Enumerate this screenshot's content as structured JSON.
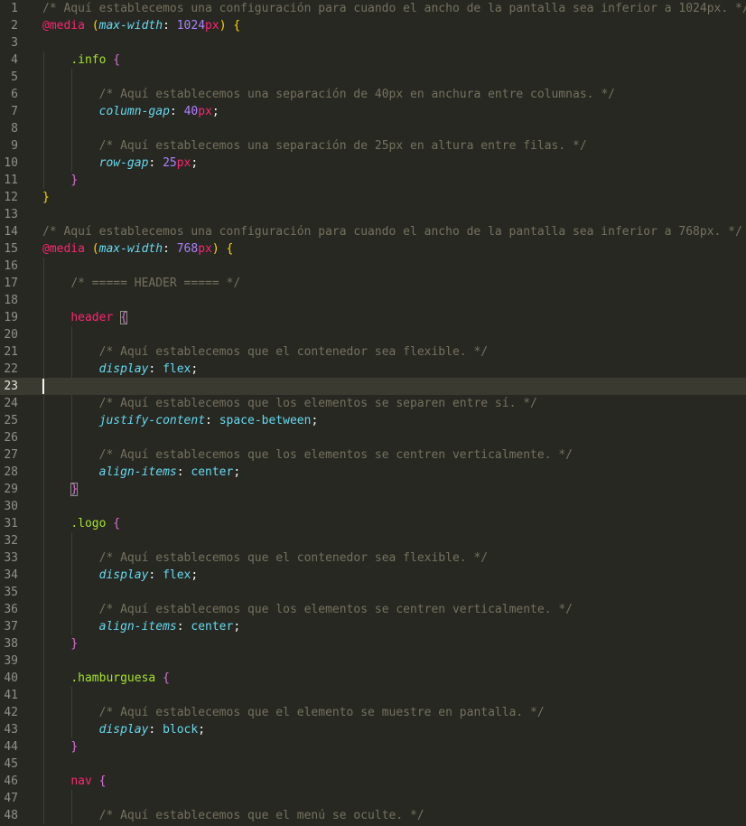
{
  "editor": {
    "active_line": 23,
    "lines": [
      {
        "n": "1",
        "tokens": [
          {
            "t": "/* Aquí establecemos una configuración para cuando el ancho de la pantalla sea inferior a 1024px. */",
            "k": "c"
          }
        ]
      },
      {
        "n": "2",
        "tokens": [
          {
            "t": "@media",
            "k": "at"
          },
          {
            "t": " "
          },
          {
            "t": "(",
            "k": "b1"
          },
          {
            "t": "max-width",
            "k": "pp"
          },
          {
            "t": ": "
          },
          {
            "t": "1024",
            "k": "n"
          },
          {
            "t": "px",
            "k": "u"
          },
          {
            "t": ")",
            "k": "b1"
          },
          {
            "t": " "
          },
          {
            "t": "{",
            "k": "b1"
          }
        ]
      },
      {
        "n": "3",
        "tokens": []
      },
      {
        "n": "4",
        "g": 1,
        "tokens": [
          {
            "t": "    "
          },
          {
            "t": ".info",
            "k": "s"
          },
          {
            "t": " "
          },
          {
            "t": "{",
            "k": "b2"
          }
        ]
      },
      {
        "n": "5",
        "g": 2,
        "tokens": []
      },
      {
        "n": "6",
        "g": 2,
        "tokens": [
          {
            "t": "        "
          },
          {
            "t": "/* Aquí establecemos una separación de 40px en anchura entre columnas. */",
            "k": "c"
          }
        ]
      },
      {
        "n": "7",
        "g": 2,
        "tokens": [
          {
            "t": "        "
          },
          {
            "t": "column-gap",
            "k": "pp"
          },
          {
            "t": ": "
          },
          {
            "t": "40",
            "k": "n"
          },
          {
            "t": "px",
            "k": "u"
          },
          {
            "t": ";"
          }
        ]
      },
      {
        "n": "8",
        "g": 2,
        "tokens": []
      },
      {
        "n": "9",
        "g": 2,
        "tokens": [
          {
            "t": "        "
          },
          {
            "t": "/* Aquí establecemos una separación de 25px en altura entre filas. */",
            "k": "c"
          }
        ]
      },
      {
        "n": "10",
        "g": 2,
        "tokens": [
          {
            "t": "        "
          },
          {
            "t": "row-gap",
            "k": "pp"
          },
          {
            "t": ": "
          },
          {
            "t": "25",
            "k": "n"
          },
          {
            "t": "px",
            "k": "u"
          },
          {
            "t": ";"
          }
        ]
      },
      {
        "n": "11",
        "g": 1,
        "tokens": [
          {
            "t": "    "
          },
          {
            "t": "}",
            "k": "b2"
          }
        ]
      },
      {
        "n": "12",
        "tokens": [
          {
            "t": "}",
            "k": "b1"
          }
        ]
      },
      {
        "n": "13",
        "tokens": []
      },
      {
        "n": "14",
        "tokens": [
          {
            "t": "/* Aquí establecemos una configuración para cuando el ancho de la pantalla sea inferior a 768px. */",
            "k": "c"
          }
        ]
      },
      {
        "n": "15",
        "tokens": [
          {
            "t": "@media",
            "k": "at"
          },
          {
            "t": " "
          },
          {
            "t": "(",
            "k": "b1"
          },
          {
            "t": "max-width",
            "k": "pp"
          },
          {
            "t": ": "
          },
          {
            "t": "768",
            "k": "n"
          },
          {
            "t": "px",
            "k": "u"
          },
          {
            "t": ")",
            "k": "b1"
          },
          {
            "t": " "
          },
          {
            "t": "{",
            "k": "b1"
          }
        ]
      },
      {
        "n": "16",
        "g": 1,
        "tokens": []
      },
      {
        "n": "17",
        "g": 1,
        "tokens": [
          {
            "t": "    "
          },
          {
            "t": "/* ===== HEADER ===== */",
            "k": "c"
          }
        ]
      },
      {
        "n": "18",
        "g": 1,
        "tokens": []
      },
      {
        "n": "19",
        "g": 1,
        "tokens": [
          {
            "t": "    "
          },
          {
            "t": "header",
            "k": "t"
          },
          {
            "t": " "
          },
          {
            "t": "{",
            "k": "b2",
            "hl": true
          }
        ]
      },
      {
        "n": "20",
        "g": 2,
        "tokens": []
      },
      {
        "n": "21",
        "g": 2,
        "tokens": [
          {
            "t": "        "
          },
          {
            "t": "/* Aquí establecemos que el contenedor sea flexible. */",
            "k": "c"
          }
        ]
      },
      {
        "n": "22",
        "g": 2,
        "tokens": [
          {
            "t": "        "
          },
          {
            "t": "display",
            "k": "pp"
          },
          {
            "t": ": "
          },
          {
            "t": "flex",
            "k": "k"
          },
          {
            "t": ";"
          }
        ]
      },
      {
        "n": "23",
        "tokens": []
      },
      {
        "n": "24",
        "g": 2,
        "tokens": [
          {
            "t": "        "
          },
          {
            "t": "/* Aquí establecemos que los elementos se separen entre sí. */",
            "k": "c"
          }
        ]
      },
      {
        "n": "25",
        "g": 2,
        "tokens": [
          {
            "t": "        "
          },
          {
            "t": "justify-content",
            "k": "pp"
          },
          {
            "t": ": "
          },
          {
            "t": "space-between",
            "k": "k"
          },
          {
            "t": ";"
          }
        ]
      },
      {
        "n": "26",
        "g": 2,
        "tokens": []
      },
      {
        "n": "27",
        "g": 2,
        "tokens": [
          {
            "t": "        "
          },
          {
            "t": "/* Aquí establecemos que los elementos se centren verticalmente. */",
            "k": "c"
          }
        ]
      },
      {
        "n": "28",
        "g": 2,
        "tokens": [
          {
            "t": "        "
          },
          {
            "t": "align-items",
            "k": "pp"
          },
          {
            "t": ": "
          },
          {
            "t": "center",
            "k": "k"
          },
          {
            "t": ";"
          }
        ]
      },
      {
        "n": "29",
        "g": 1,
        "tokens": [
          {
            "t": "    "
          },
          {
            "t": "}",
            "k": "b2",
            "hl": true
          }
        ]
      },
      {
        "n": "30",
        "g": 1,
        "tokens": []
      },
      {
        "n": "31",
        "g": 1,
        "tokens": [
          {
            "t": "    "
          },
          {
            "t": ".logo",
            "k": "s"
          },
          {
            "t": " "
          },
          {
            "t": "{",
            "k": "b2"
          }
        ]
      },
      {
        "n": "32",
        "g": 2,
        "tokens": []
      },
      {
        "n": "33",
        "g": 2,
        "tokens": [
          {
            "t": "        "
          },
          {
            "t": "/* Aquí establecemos que el contenedor sea flexible. */",
            "k": "c"
          }
        ]
      },
      {
        "n": "34",
        "g": 2,
        "tokens": [
          {
            "t": "        "
          },
          {
            "t": "display",
            "k": "pp"
          },
          {
            "t": ": "
          },
          {
            "t": "flex",
            "k": "k"
          },
          {
            "t": ";"
          }
        ]
      },
      {
        "n": "35",
        "g": 2,
        "tokens": []
      },
      {
        "n": "36",
        "g": 2,
        "tokens": [
          {
            "t": "        "
          },
          {
            "t": "/* Aquí establecemos que los elementos se centren verticalmente. */",
            "k": "c"
          }
        ]
      },
      {
        "n": "37",
        "g": 2,
        "tokens": [
          {
            "t": "        "
          },
          {
            "t": "align-items",
            "k": "pp"
          },
          {
            "t": ": "
          },
          {
            "t": "center",
            "k": "k"
          },
          {
            "t": ";"
          }
        ]
      },
      {
        "n": "38",
        "g": 1,
        "tokens": [
          {
            "t": "    "
          },
          {
            "t": "}",
            "k": "b2"
          }
        ]
      },
      {
        "n": "39",
        "g": 1,
        "tokens": []
      },
      {
        "n": "40",
        "g": 1,
        "tokens": [
          {
            "t": "    "
          },
          {
            "t": ".hamburguesa",
            "k": "s"
          },
          {
            "t": " "
          },
          {
            "t": "{",
            "k": "b2"
          }
        ]
      },
      {
        "n": "41",
        "g": 2,
        "tokens": []
      },
      {
        "n": "42",
        "g": 2,
        "tokens": [
          {
            "t": "        "
          },
          {
            "t": "/* Aquí establecemos que el elemento se muestre en pantalla. */",
            "k": "c"
          }
        ]
      },
      {
        "n": "43",
        "g": 2,
        "tokens": [
          {
            "t": "        "
          },
          {
            "t": "display",
            "k": "pp"
          },
          {
            "t": ": "
          },
          {
            "t": "block",
            "k": "k"
          },
          {
            "t": ";"
          }
        ]
      },
      {
        "n": "44",
        "g": 1,
        "tokens": [
          {
            "t": "    "
          },
          {
            "t": "}",
            "k": "b2"
          }
        ]
      },
      {
        "n": "45",
        "g": 1,
        "tokens": []
      },
      {
        "n": "46",
        "g": 1,
        "tokens": [
          {
            "t": "    "
          },
          {
            "t": "nav",
            "k": "t"
          },
          {
            "t": " "
          },
          {
            "t": "{",
            "k": "b2"
          }
        ]
      },
      {
        "n": "47",
        "g": 2,
        "tokens": []
      },
      {
        "n": "48",
        "g": 2,
        "tokens": [
          {
            "t": "        "
          },
          {
            "t": "/* Aquí establecemos que el menú se oculte. */",
            "k": "c"
          }
        ]
      }
    ]
  }
}
